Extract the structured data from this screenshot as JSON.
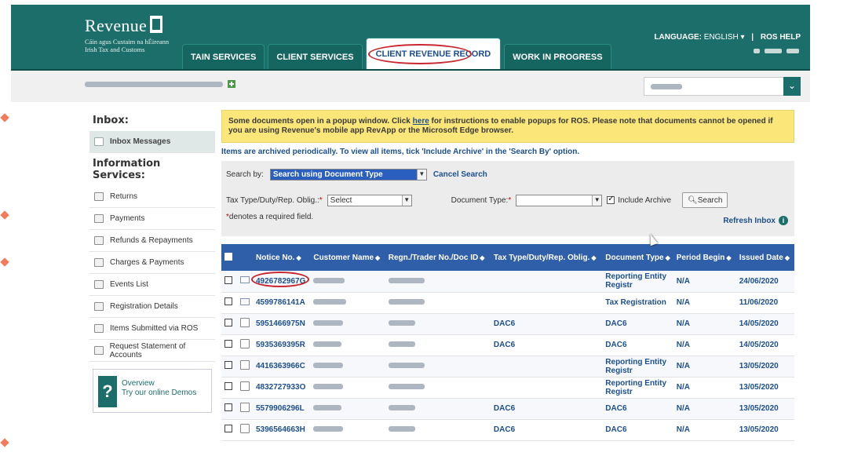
{
  "header": {
    "logo_word": "Revenue",
    "logo_sub1": "Cáin agus Custaim na hÉireann",
    "logo_sub2": "Irish Tax and Customs",
    "tabs": [
      {
        "label": "TAIN SERVICES"
      },
      {
        "label": "CLIENT SERVICES"
      },
      {
        "label": "CLIENT REVENUE RECORD"
      },
      {
        "label": "WORK IN PROGRESS"
      }
    ],
    "language_label": "LANGUAGE:",
    "language_value": "ENGLISH",
    "ros_help": "ROS HELP"
  },
  "sidebar": {
    "inbox_heading": "Inbox:",
    "inbox_item": "Inbox Messages",
    "info_heading": "Information Services:",
    "items": [
      {
        "label": "Returns",
        "icon": "returns-icon"
      },
      {
        "label": "Payments",
        "icon": "payments-icon"
      },
      {
        "label": "Refunds & Repayments",
        "icon": "refunds-icon"
      },
      {
        "label": "Charges & Payments",
        "icon": "charges-icon"
      },
      {
        "label": "Events List",
        "icon": "events-icon"
      },
      {
        "label": "Registration Details",
        "icon": "registration-icon"
      },
      {
        "label": "Items Submitted via ROS",
        "icon": "submitted-icon"
      },
      {
        "label": "Request Statement of Accounts",
        "icon": "statement-icon"
      }
    ],
    "help_title": "Overview",
    "help_link": "Try our online Demos"
  },
  "main": {
    "notice_pre": "Some documents open in a popup window. Click ",
    "notice_link": "here",
    "notice_post": " for instructions to enable popups for ROS. Please note that documents cannot be opened if you are using Revenue's mobile app RevApp or the Microsoft Edge browser.",
    "archived_text": "Items are archived periodically. To view all items, tick 'Include Archive' in the 'Search By' option.",
    "search_by_label": "Search by:",
    "search_by_value": "Search using Document Type",
    "cancel_search": "Cancel Search",
    "tax_type_label": "Tax Type/Duty/Rep. Oblig.:",
    "tax_type_value": "Select",
    "doc_type_label": "Document Type:",
    "doc_type_value": "",
    "include_archive": "Include Archive",
    "search_button": "Search",
    "required_note": "denotes a required field.",
    "refresh_inbox": "Refresh Inbox"
  },
  "table": {
    "headers": [
      "Notice No.",
      "Customer Name",
      "Regn./Trader No./Doc ID",
      "Tax Type/Duty/Rep. Oblig.",
      "Document Type",
      "Period Begin",
      "Issued Date"
    ],
    "rows": [
      {
        "notice": "4926782967G",
        "tax": "",
        "doc": "Reporting Entity Registr",
        "period": "N/A",
        "date": "24/06/2020",
        "unread": true
      },
      {
        "notice": "4599786141A",
        "tax": "",
        "doc": "Tax Registration",
        "period": "N/A",
        "date": "11/06/2020",
        "unread": true
      },
      {
        "notice": "5951466975N",
        "tax": "DAC6",
        "doc": "DAC6",
        "period": "N/A",
        "date": "14/05/2020",
        "unread": false
      },
      {
        "notice": "5935369395R",
        "tax": "DAC6",
        "doc": "DAC6",
        "period": "N/A",
        "date": "14/05/2020",
        "unread": false
      },
      {
        "notice": "4416363966C",
        "tax": "",
        "doc": "Reporting Entity Registr",
        "period": "N/A",
        "date": "13/05/2020",
        "unread": false
      },
      {
        "notice": "4832727933O",
        "tax": "",
        "doc": "Reporting Entity Registr",
        "period": "N/A",
        "date": "13/05/2020",
        "unread": false
      },
      {
        "notice": "5579906296L",
        "tax": "DAC6",
        "doc": "DAC6",
        "period": "N/A",
        "date": "13/05/2020",
        "unread": false
      },
      {
        "notice": "5396564663H",
        "tax": "DAC6",
        "doc": "DAC6",
        "period": "N/A",
        "date": "13/05/2020",
        "unread": false
      }
    ]
  }
}
